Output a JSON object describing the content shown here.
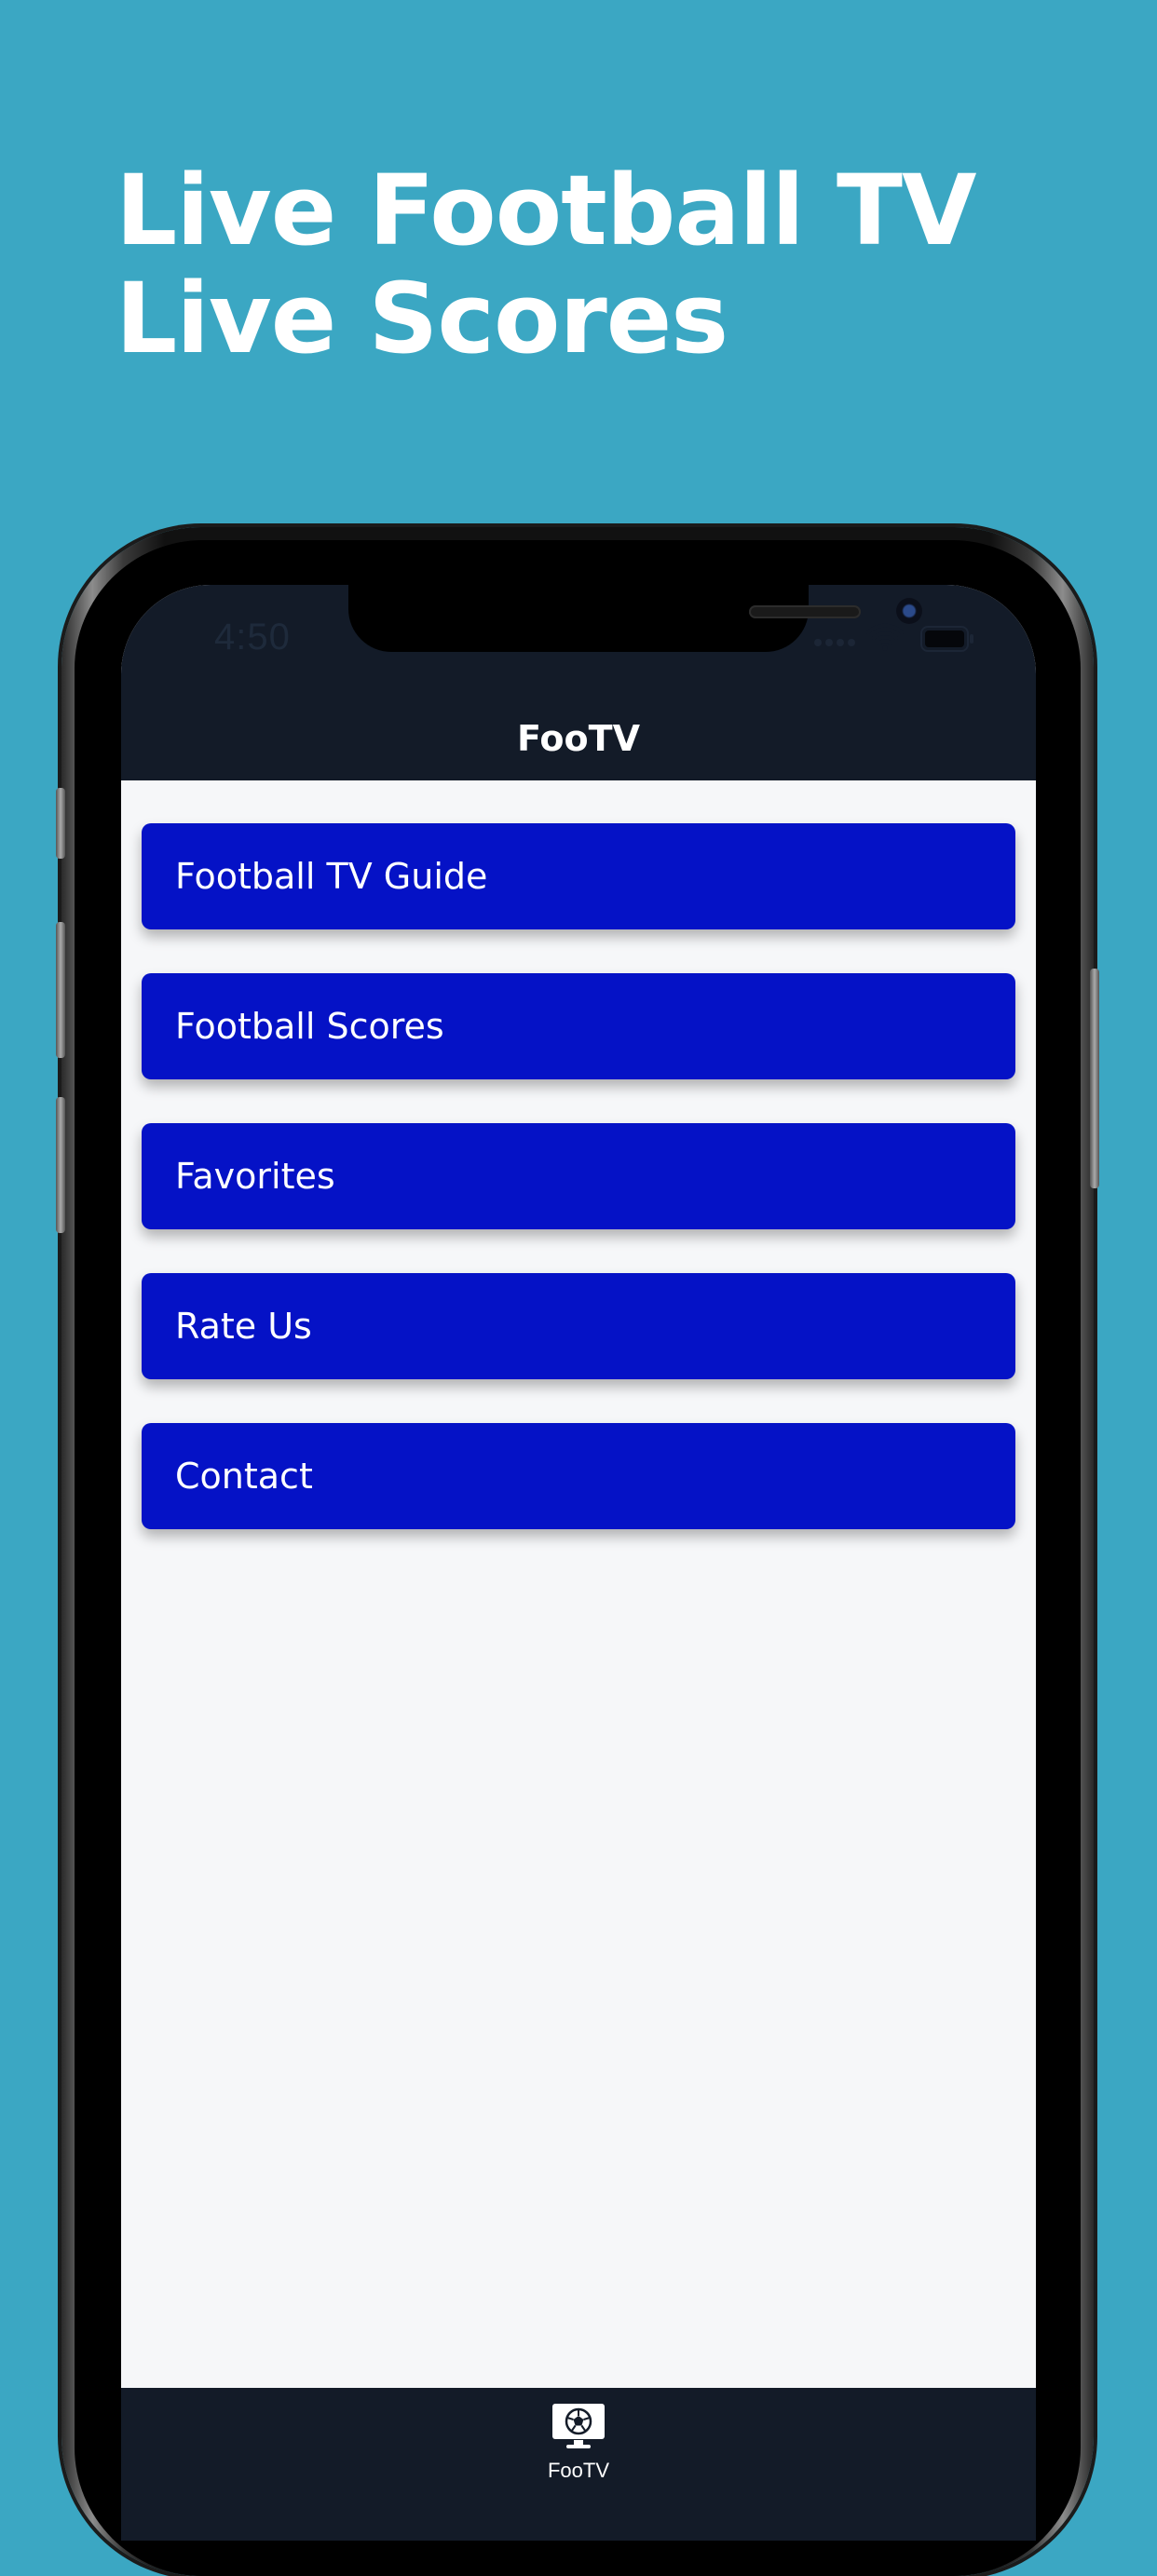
{
  "headline": {
    "line1": "Live Football TV",
    "line2": "Live Scores"
  },
  "status_bar": {
    "time": "4:50"
  },
  "nav": {
    "title": "FooTV"
  },
  "menu": {
    "items": [
      {
        "label": "Football TV Guide"
      },
      {
        "label": "Football Scores"
      },
      {
        "label": "Favorites"
      },
      {
        "label": "Rate Us"
      },
      {
        "label": "Contact"
      }
    ]
  },
  "tab_bar": {
    "items": [
      {
        "label": "FooTV",
        "icon": "tv-football-icon"
      }
    ]
  },
  "colors": {
    "background": "#3ba7c3",
    "bar": "#131b28",
    "button": "#0512c6",
    "screen": "#f6f7f9"
  }
}
